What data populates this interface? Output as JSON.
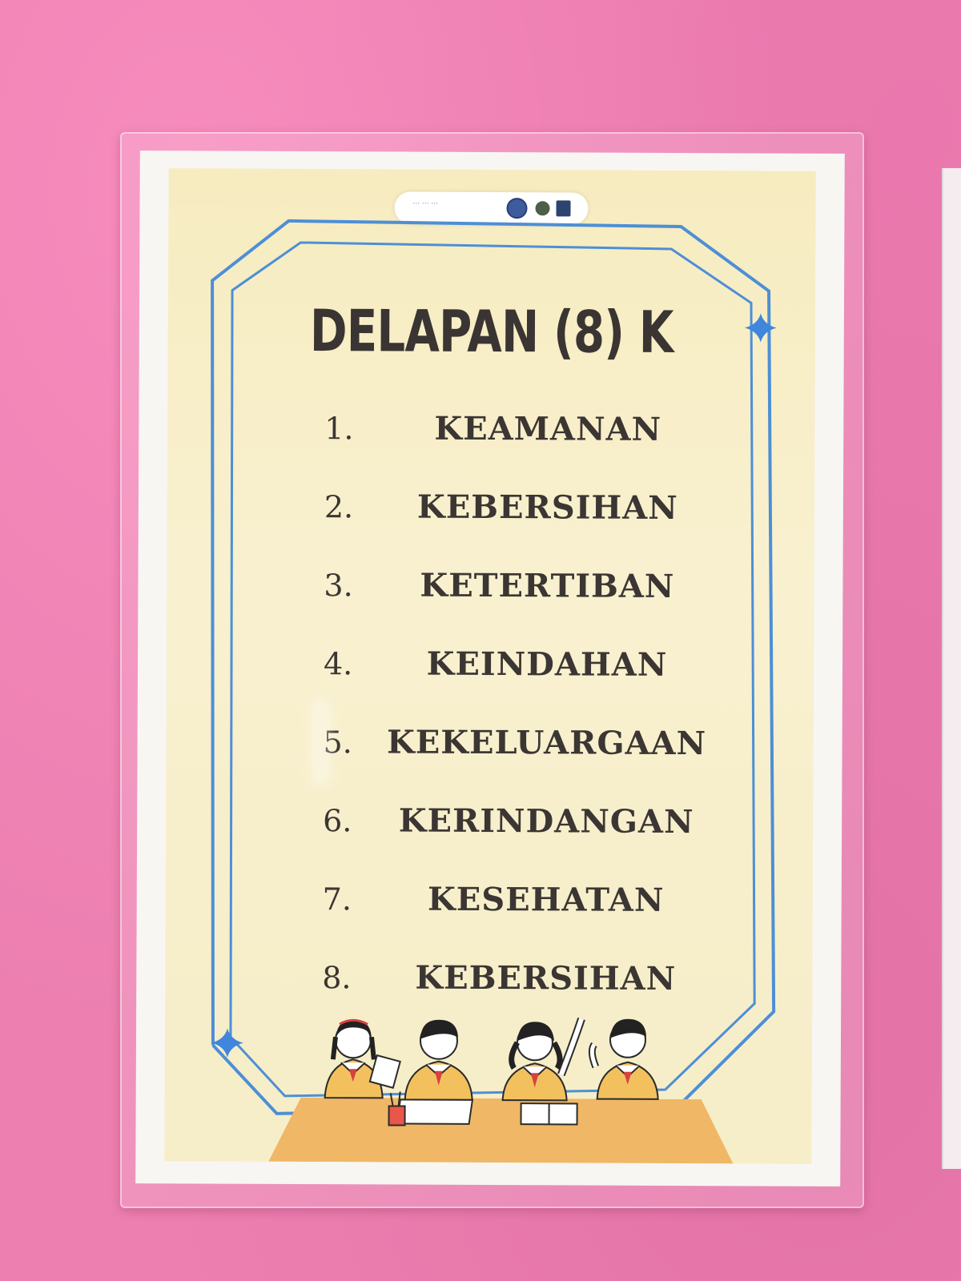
{
  "poster": {
    "title": "DELAPAN (8) K",
    "items": [
      {
        "number": "1.",
        "label": "KEAMANAN"
      },
      {
        "number": "2.",
        "label": "KEBERSIHAN"
      },
      {
        "number": "3.",
        "label": "KETERTIBAN"
      },
      {
        "number": "4.",
        "label": "KEINDAHAN"
      },
      {
        "number": "5.",
        "label": "KEKELUARGAAN"
      },
      {
        "number": "6.",
        "label": "KERINDANGAN"
      },
      {
        "number": "7.",
        "label": "KESEHATAN"
      },
      {
        "number": "8.",
        "label": "KEBERSIHAN"
      }
    ],
    "colors": {
      "wall": "#ec7fb0",
      "poster_background": "#f8efc6",
      "frame_line": "#4d8fd6",
      "text": "#3b3633",
      "desk": "#f0b766"
    },
    "illustration": "students-at-desk"
  }
}
